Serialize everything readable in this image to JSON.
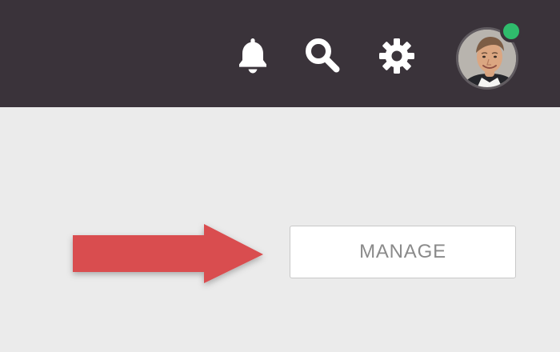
{
  "header": {
    "notification_icon": "bell-icon",
    "search_icon": "search-icon",
    "settings_icon": "gear-icon",
    "avatar": "user-avatar",
    "presence_status": "online"
  },
  "annotation": {
    "pointer": "red-arrow-icon"
  },
  "actions": {
    "manage_label": "MANAGE"
  },
  "colors": {
    "topbar": "#3a333a",
    "background": "#ebebeb",
    "icon": "#ffffff",
    "status_online": "#2fbc6c",
    "arrow": "#d94d4f",
    "button_text": "#8a8a8a"
  }
}
